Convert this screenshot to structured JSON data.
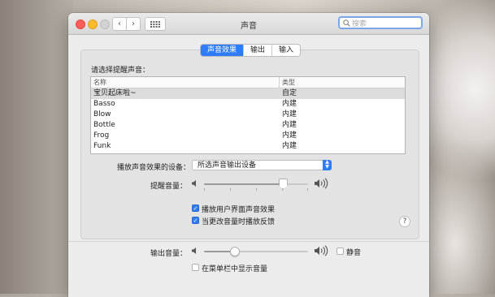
{
  "window": {
    "title": "声音"
  },
  "toolbar": {
    "back_glyph": "‹",
    "forward_glyph": "›"
  },
  "search": {
    "placeholder": "搜索"
  },
  "tabs": [
    {
      "label": "声音效果",
      "active": true
    },
    {
      "label": "输出",
      "active": false
    },
    {
      "label": "输入",
      "active": false
    }
  ],
  "alerts": {
    "prompt": "请选择提醒声音：",
    "columns": {
      "name": "名称",
      "type": "类型"
    },
    "rows": [
      {
        "name": "宝贝起床啦~",
        "type": "自定",
        "selected": true
      },
      {
        "name": "Basso",
        "type": "内建",
        "selected": false
      },
      {
        "name": "Blow",
        "type": "内建",
        "selected": false
      },
      {
        "name": "Bottle",
        "type": "内建",
        "selected": false
      },
      {
        "name": "Frog",
        "type": "内建",
        "selected": false
      },
      {
        "name": "Funk",
        "type": "内建",
        "selected": false
      }
    ]
  },
  "device": {
    "label": "播放声音效果的设备：",
    "value": "所选声音输出设备"
  },
  "alert_volume": {
    "label": "提醒音量：",
    "level": 0.76
  },
  "options": {
    "ui_sounds": {
      "label": "播放用户界面声音效果",
      "checked": true
    },
    "feedback": {
      "label": "当更改音量时播放反馈",
      "checked": true
    }
  },
  "help": {
    "glyph": "?"
  },
  "output_volume": {
    "label": "输出音量：",
    "level": 0.3
  },
  "mute": {
    "label": "静音",
    "checked": false
  },
  "menubar_volume": {
    "label": "在菜单栏中显示音量",
    "checked": false
  },
  "colors": {
    "accent": "#2f7cf6",
    "search_ring": "#7aa7e8"
  },
  "icons": {
    "speaker_low": "speaker-low-icon",
    "speaker_high": "speaker-high-icon",
    "search": "search-icon",
    "grid": "grid-icon",
    "checkmark": "checkmark-icon"
  }
}
